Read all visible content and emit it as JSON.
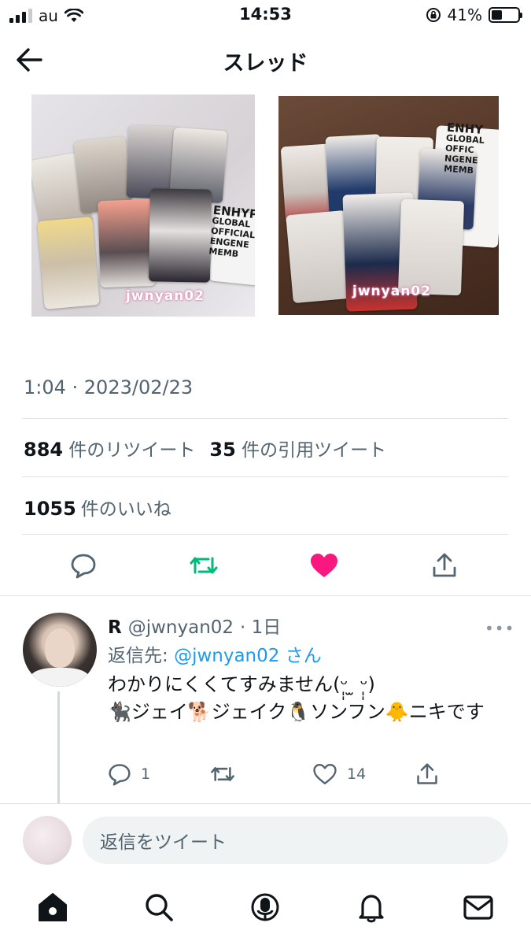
{
  "status_bar": {
    "carrier": "au",
    "time": "14:53",
    "battery_percent": "41%",
    "battery_level": 0.41,
    "signal_bars": 3
  },
  "header": {
    "title": "スレッド"
  },
  "media": {
    "photo1_watermark": "jwnyan02",
    "photo1_caption": [
      "ENHYPE",
      "GLOBAL OFFICIAL",
      "ENGENE MEMB"
    ],
    "photo2_watermark": "jwnyan02",
    "photo2_caption": [
      "ENHY",
      "GLOBAL OFFIC",
      "NGENE MEMB"
    ]
  },
  "tweet": {
    "timestamp": "1:04 · 2023/02/23",
    "retweet_count": "884",
    "retweet_label": "件のリツイート",
    "quote_count": "35",
    "quote_label": "件の引用ツイート",
    "like_count": "1055",
    "like_label": "件のいいね",
    "liked": true
  },
  "reply": {
    "name": "R",
    "handle": "@jwnyan02",
    "time": "· 1日",
    "reply_to_prefix": "返信先: ",
    "reply_to_handle": "@jwnyan02",
    "reply_to_suffix": "さん",
    "line1": "わかりにくくてすみません(ᵕ̩̩ ̫ ᵕ̩̩)",
    "line2": "🐈‍⬛ジェイ🐕ジェイク🐧ソンフン🐥ニキです",
    "reply_count": "1",
    "like_count": "14"
  },
  "compose": {
    "placeholder": "返信をツイート"
  },
  "colors": {
    "accent": "#1d9bf0",
    "retweet_green": "#00ba7c",
    "like_pink": "#f91880",
    "secondary_text": "#536471"
  },
  "tabbar": {
    "items": [
      "home-icon",
      "search-icon",
      "spaces-icon",
      "notifications-icon",
      "messages-icon"
    ]
  }
}
